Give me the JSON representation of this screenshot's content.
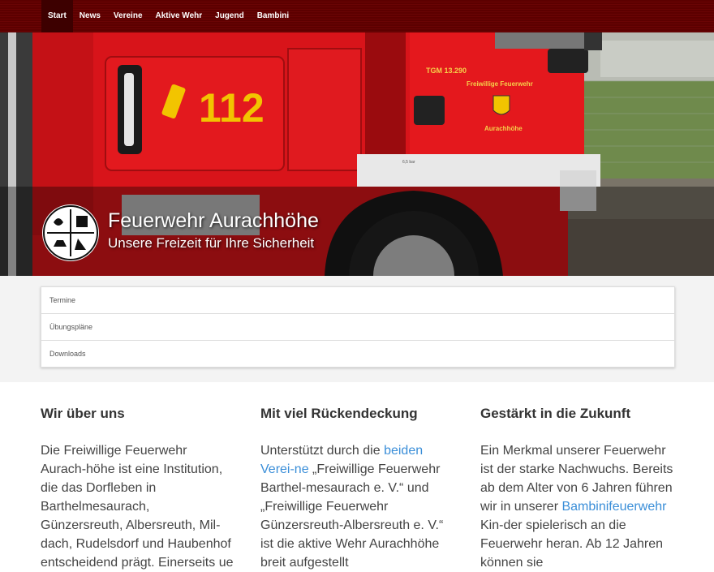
{
  "nav": {
    "items": [
      {
        "label": "Start",
        "active": true
      },
      {
        "label": "News"
      },
      {
        "label": "Vereine"
      },
      {
        "label": "Aktive Wehr"
      },
      {
        "label": "Jugend"
      },
      {
        "label": "Bambini"
      }
    ]
  },
  "hero": {
    "title": "Feuerwehr Aurachhöhe",
    "subtitle": "Unsere Freizeit für Ihre Sicherheit",
    "truck_number": "112",
    "truck_model": "TGM 13.290",
    "door_text_1": "Freiwillige Feuerwehr",
    "door_text_2": "Aurachhöhe",
    "tire_label": "6,5 bar"
  },
  "links": [
    "Termine",
    "Übungspläne",
    "Downloads"
  ],
  "columns": [
    {
      "title": "Wir über uns",
      "text": "Die Freiwillige Feuerwehr Aurach-höhe ist eine Institution, die das Dorfleben in Barthelmesaurach, Günzersreuth, Albersreuth, Mil-dach, Rudelsdorf und Haubenhof entscheidend prägt. Einerseits ue"
    },
    {
      "title": "Mit viel Rückendeckung",
      "pre": "Unterstützt durch die ",
      "link": "beiden Verei-ne",
      "post": " „Freiwillige Feuerwehr Barthel-mesaurach e. V.“ und „Freiwillige Feuerwehr Günzersreuth-Albersreuth e. V.“ ist die aktive Wehr Aurachhöhe breit aufgestellt"
    },
    {
      "title": "Gestärkt in die Zukunft",
      "pre": "Ein Merkmal unserer Feuerwehr ist der starke Nachwuchs. Bereits ab dem Alter von 6 Jahren führen wir in unserer ",
      "link": "Bambinifeuerwehr",
      "post": " Kin-der spielerisch an die Feuerwehr heran. Ab 12 Jahren können sie"
    }
  ],
  "colors": {
    "nav_bg": "#5c0000",
    "truck_red": "#e0161b",
    "link": "#3a8ed8"
  }
}
